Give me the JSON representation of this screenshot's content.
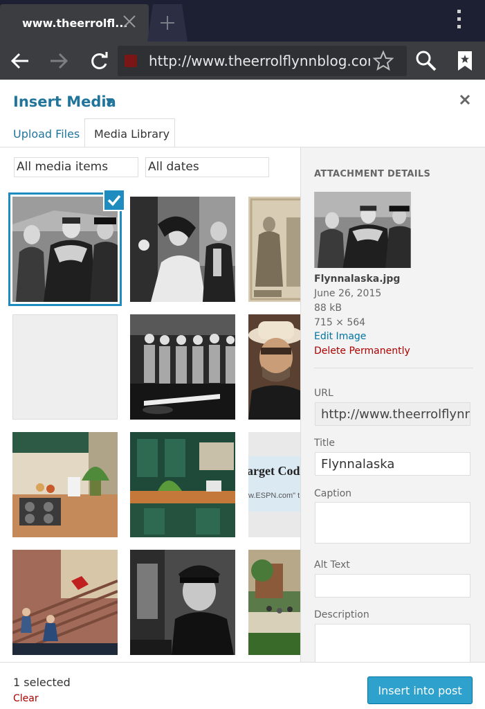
{
  "browser": {
    "tab_title": "www.theerrolfl...",
    "url": "http://www.theerrolflynnblog.con",
    "icons": [
      "close-icon",
      "new-tab-icon",
      "menu-icon",
      "back-icon",
      "forward-icon",
      "reload-icon",
      "star-icon",
      "search-icon",
      "bookmarks-icon"
    ]
  },
  "modal": {
    "title": "Insert Media",
    "title_caret": "▼",
    "tabs": {
      "upload": "Upload Files",
      "library": "Media Library"
    },
    "filters": {
      "type": "All media items",
      "date": "All dates"
    }
  },
  "grid": {
    "thumbnails": [
      "Errol Flynn in Alaska (selected)",
      "Costume drama scene",
      "Vintage lobby card",
      "Blank placeholder",
      "Cadets in uniform",
      "Man in cowboy hat",
      "Kitchen interior",
      "Green kitchen",
      "Target Code screenshot",
      "Staircase fight scene",
      "Man in officer cap",
      "Outdoor crowd"
    ],
    "partial_text": {
      "line1": "arget Code",
      "line2": "w.ESPN.com\" t"
    }
  },
  "details": {
    "heading": "ATTACHMENT DETAILS",
    "filename": "Flynnalaska.jpg",
    "date": "June 26, 2015",
    "size": "88 kB",
    "dimensions": "715 × 564",
    "edit_link": "Edit Image",
    "delete_link": "Delete Permanently",
    "url_label": "URL",
    "url_value": "http://www.theerrolflynn",
    "title_label": "Title",
    "title_value": "Flynnalaska",
    "caption_label": "Caption",
    "alt_label": "Alt Text",
    "description_label": "Description"
  },
  "footer": {
    "selected": "1 selected",
    "clear": "Clear",
    "insert": "Insert into post"
  },
  "colors": {
    "accent": "#21759b",
    "button": "#2ea2cc",
    "delete": "#aa0000"
  }
}
